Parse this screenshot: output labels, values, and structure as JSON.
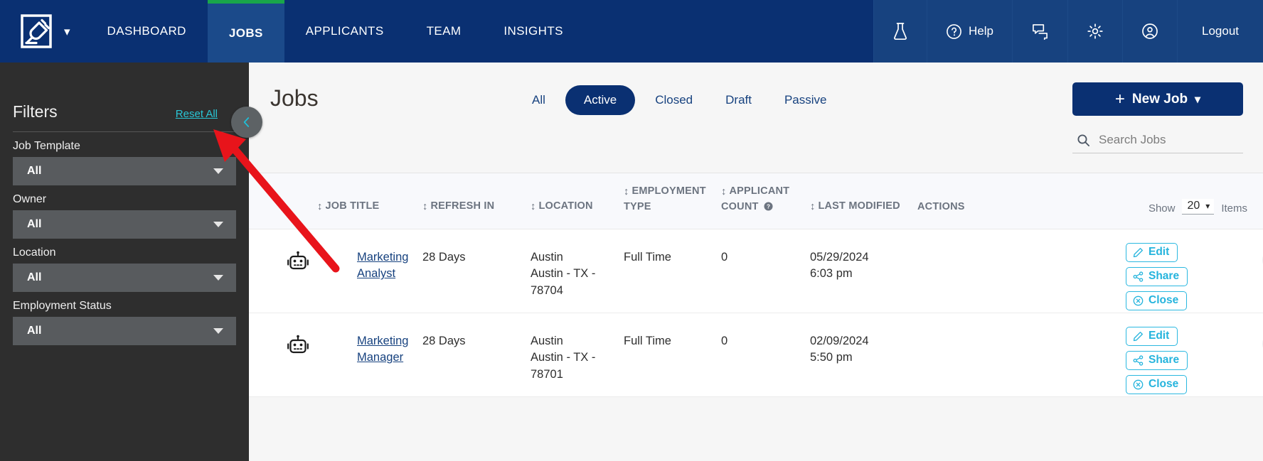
{
  "topnav": {
    "logo_icon": "plug-in-square-logo",
    "logo_caret_icon": "chevron-down-icon",
    "items": [
      {
        "label": "DASHBOARD",
        "active": false
      },
      {
        "label": "JOBS",
        "active": true
      },
      {
        "label": "APPLICANTS",
        "active": false
      },
      {
        "label": "TEAM",
        "active": false
      },
      {
        "label": "INSIGHTS",
        "active": false
      }
    ],
    "right_items": [
      {
        "label": "",
        "icon": "flask-icon",
        "name": "lab-flask"
      },
      {
        "label": "Help",
        "icon": "question-circle-icon",
        "name": "help"
      },
      {
        "label": "",
        "icon": "chat-bubbles-icon",
        "name": "messages"
      },
      {
        "label": "",
        "icon": "gear-icon",
        "name": "settings"
      },
      {
        "label": "",
        "icon": "user-circle-icon",
        "name": "account"
      },
      {
        "label": "Logout",
        "icon": "",
        "name": "logout"
      }
    ],
    "accent_active": "#19a64a",
    "brand_blue": "#0a3072"
  },
  "sidebar": {
    "title": "Filters",
    "reset_label": "Reset All",
    "reset_color": "#29c6d6",
    "filters": [
      {
        "label": "Job Template",
        "value": "All"
      },
      {
        "label": "Owner",
        "value": "All"
      },
      {
        "label": "Location",
        "value": "All"
      },
      {
        "label": "Employment Status",
        "value": "All"
      }
    ],
    "collapse_icon": "chevron-left-icon"
  },
  "main": {
    "page_title": "Jobs",
    "tabs": [
      {
        "label": "All",
        "active": false
      },
      {
        "label": "Active",
        "active": true
      },
      {
        "label": "Closed",
        "active": false
      },
      {
        "label": "Draft",
        "active": false
      },
      {
        "label": "Passive",
        "active": false
      }
    ],
    "new_job": {
      "plus": "+",
      "label": "New Job",
      "chevron": "chevron-down-icon"
    },
    "search": {
      "placeholder": "Search Jobs",
      "icon": "search-icon",
      "value": ""
    }
  },
  "table": {
    "columns": [
      {
        "key": "job_title",
        "label": "JOB TITLE",
        "sortable": true
      },
      {
        "key": "refresh_in",
        "label": "REFRESH IN",
        "sortable": true
      },
      {
        "key": "location",
        "label": "LOCATION",
        "sortable": true
      },
      {
        "key": "employment_type",
        "label": "EMPLOYMENT TYPE",
        "sortable": true
      },
      {
        "key": "applicant_count",
        "label": "APPLICANT COUNT",
        "sortable": true,
        "help_icon": "question-circle-icon"
      },
      {
        "key": "last_modified",
        "label": "LAST MODIFIED",
        "sortable": true
      },
      {
        "key": "actions",
        "label": "ACTIONS",
        "sortable": false
      }
    ],
    "pagination": {
      "show_label": "Show",
      "page_size": "20",
      "items_label": "Items"
    },
    "row_icon": "robot-icon",
    "action_buttons": [
      {
        "label": "Edit",
        "icon": "pencil-icon"
      },
      {
        "label": "Share",
        "icon": "share-nodes-icon"
      },
      {
        "label": "Close",
        "icon": "circle-x-icon"
      }
    ],
    "kebab_icon": "three-dots-vertical-icon",
    "rows": [
      {
        "job_title": "Marketing Analyst",
        "refresh_in": "28 Days",
        "location_line1": "Austin",
        "location_line2": "Austin - TX -",
        "location_line3": "78704",
        "employment_type": "Full Time",
        "applicant_count": "0",
        "last_modified_date": "05/29/2024",
        "last_modified_time": "6:03 pm"
      },
      {
        "job_title": "Marketing Manager",
        "refresh_in": "28 Days",
        "location_line1": "Austin",
        "location_line2": "Austin - TX -",
        "location_line3": "78701",
        "employment_type": "Full Time",
        "applicant_count": "0",
        "last_modified_date": "02/09/2024",
        "last_modified_time": "5:50 pm"
      }
    ]
  },
  "annotation": {
    "arrow_color": "#e8141b",
    "points_to": "Reset All"
  }
}
